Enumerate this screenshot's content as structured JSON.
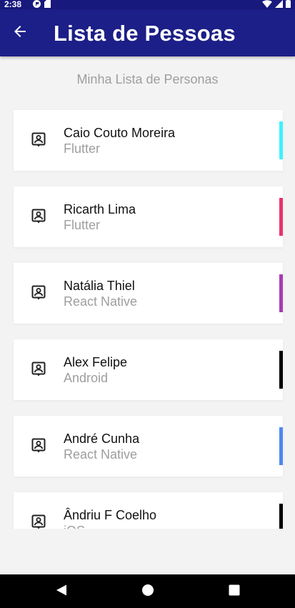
{
  "status_bar": {
    "time": "2:38",
    "left_icons": [
      "app-notification-icon",
      "sd-card-icon"
    ],
    "right_icons": [
      "wifi-icon",
      "signal-icon",
      "battery-icon"
    ]
  },
  "app_bar": {
    "title": "Lista de Pessoas",
    "back_icon": "arrow-back-icon"
  },
  "subtitle": "Minha Lista de Personas",
  "people": [
    {
      "name": "Caio Couto Moreira",
      "tech": "Flutter",
      "accent": "#3cf3ff"
    },
    {
      "name": "Ricarth Lima",
      "tech": "Flutter",
      "accent": "#e8336c"
    },
    {
      "name": "Natália Thiel",
      "tech": "React Native",
      "accent": "#a93bb4"
    },
    {
      "name": "Alex Felipe",
      "tech": "Android",
      "accent": "#000000"
    },
    {
      "name": "André Cunha",
      "tech": "React Native",
      "accent": "#4f87ee"
    },
    {
      "name": "Ândriu F Coelho",
      "tech": "iOS",
      "accent": "#000000"
    }
  ],
  "colors": {
    "app_bar": "#1c1f87",
    "status_bar": "#18197d",
    "background": "#f3f3f3"
  },
  "nav_bar": [
    "back-triangle-icon",
    "home-circle-icon",
    "recents-square-icon"
  ]
}
